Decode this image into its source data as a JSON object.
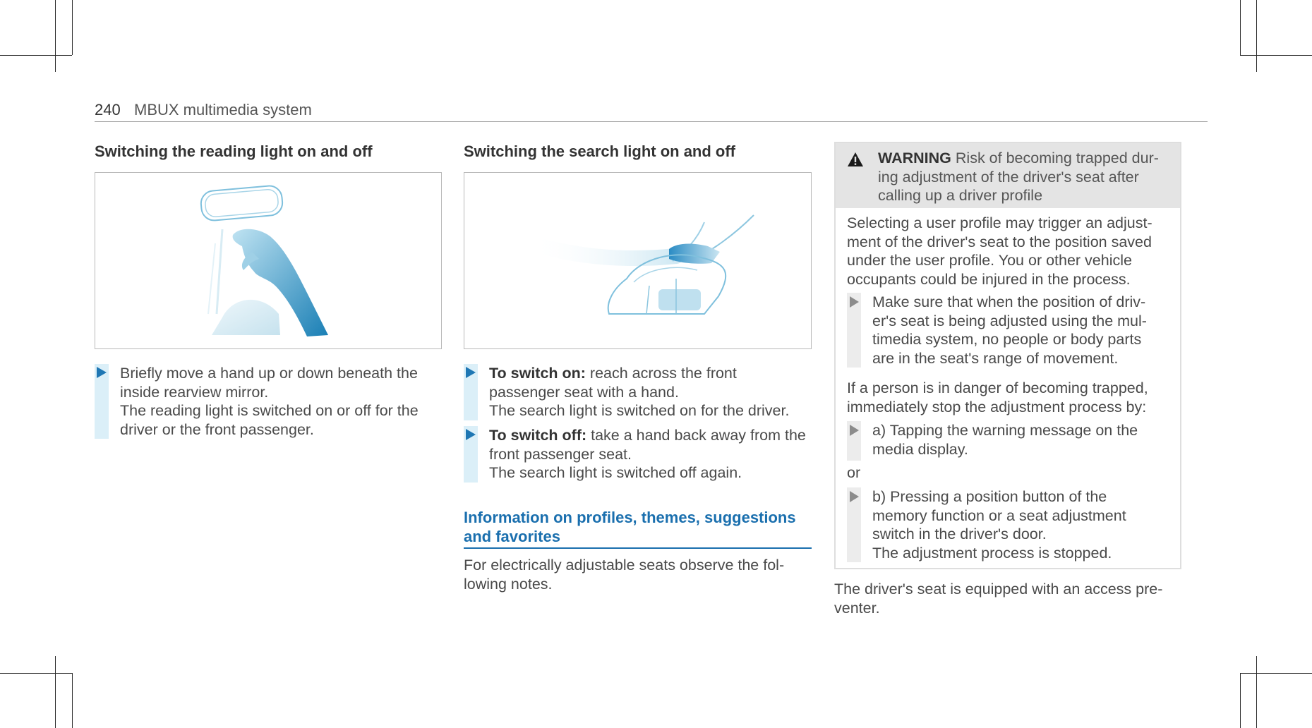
{
  "header": {
    "page_number": "240",
    "section": "MBUX multimedia system"
  },
  "col1": {
    "heading": "Switching the reading light on and off",
    "step_text": "Briefly move a hand up or down beneath the\ninside rearview mirror.\nThe reading light is switched on or off for the\ndriver or the front passenger."
  },
  "col2": {
    "heading": "Switching the search light on and off",
    "step1_label": "To switch on:",
    "step1_text": " reach across the front\npassenger seat with a hand.\nThe search light is switched on for the driver.",
    "step2_label": "To switch off:",
    "step2_text": " take a hand back away from the\nfront passenger seat.\nThe search light is switched off again.",
    "section_heading": "Information on profiles, themes, suggestions and favorites",
    "section_text": "For electrically adjustable seats observe the fol-\nlowing notes."
  },
  "warning": {
    "label": "WARNING",
    "title": " Risk of becoming trapped dur-\ning adjustment of the driver's seat after\ncalling up a driver profile",
    "intro": "Selecting a user profile may trigger an adjust-\nment of the driver's seat to the position saved\nunder the user profile. You or other vehicle\noccupants could be injured in the process.",
    "step1": "Make sure that when the position of driv-\ner's seat is being adjusted using the mul-\ntimedia system, no people or body parts\nare in the seat's range of movement.",
    "danger_text": "If a person is in danger of becoming trapped,\nimmediately stop the adjustment process by:",
    "step2": "a) Tapping the warning message on the\nmedia display.",
    "or_text": "or",
    "step3": "b) Pressing a position button of the\nmemory function or a seat adjustment\nswitch in the driver's door.\nThe adjustment process is stopped."
  },
  "footer_text": "The driver's seat is equipped with an access pre-\nventer.",
  "colors": {
    "accent": "#1a6fae",
    "arrow": "#1f77b4",
    "step_bar": "#dbeff8"
  }
}
